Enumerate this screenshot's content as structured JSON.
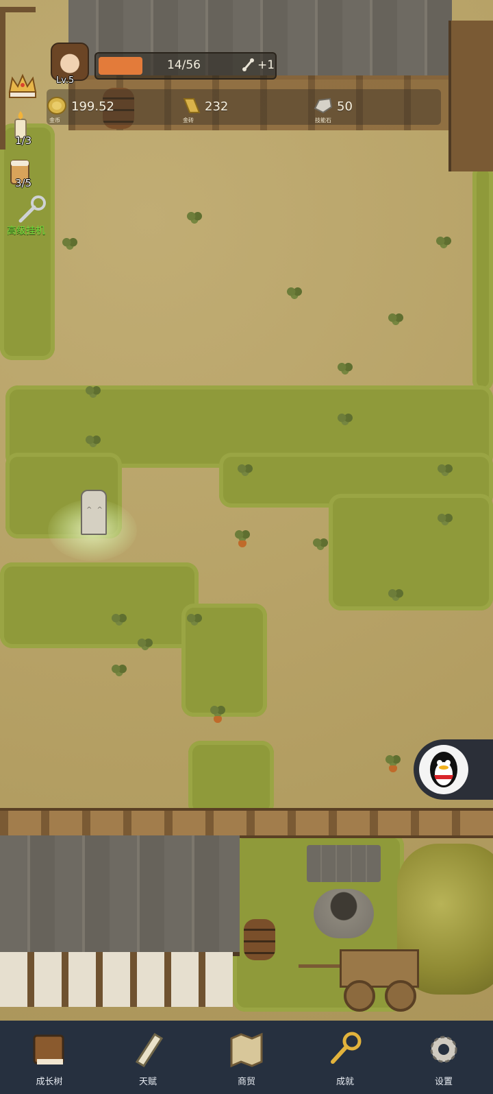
{
  "hud": {
    "level": "Lv.5",
    "xp_text": "14/56",
    "xp_fraction": 0.25,
    "xp_bonus": "+1"
  },
  "resources": [
    {
      "name": "gold-coin",
      "value": "199.52",
      "caption": "金币",
      "icon": "gold-coin-icon"
    },
    {
      "name": "gold-brick",
      "value": "232",
      "caption": "金砖",
      "icon": "gold-brick-icon"
    },
    {
      "name": "skill-stone",
      "value": "50",
      "caption": "技能石",
      "icon": "skill-stone-icon"
    }
  ],
  "sidebar": {
    "candle_count": "1/3",
    "beer_count": "3/5",
    "idle_label": "高级挂机"
  },
  "nav": [
    {
      "label": "成长树",
      "icon": "book-icon"
    },
    {
      "label": "天赋",
      "icon": "scroll-icon"
    },
    {
      "label": "商贸",
      "icon": "map-icon"
    },
    {
      "label": "成就",
      "icon": "key-icon"
    },
    {
      "label": "设置",
      "icon": "gear-icon"
    }
  ],
  "colors": {
    "xp_fill": "#e37b3a",
    "nav_background": "#26303f",
    "idle_label": "#6dde3a"
  }
}
